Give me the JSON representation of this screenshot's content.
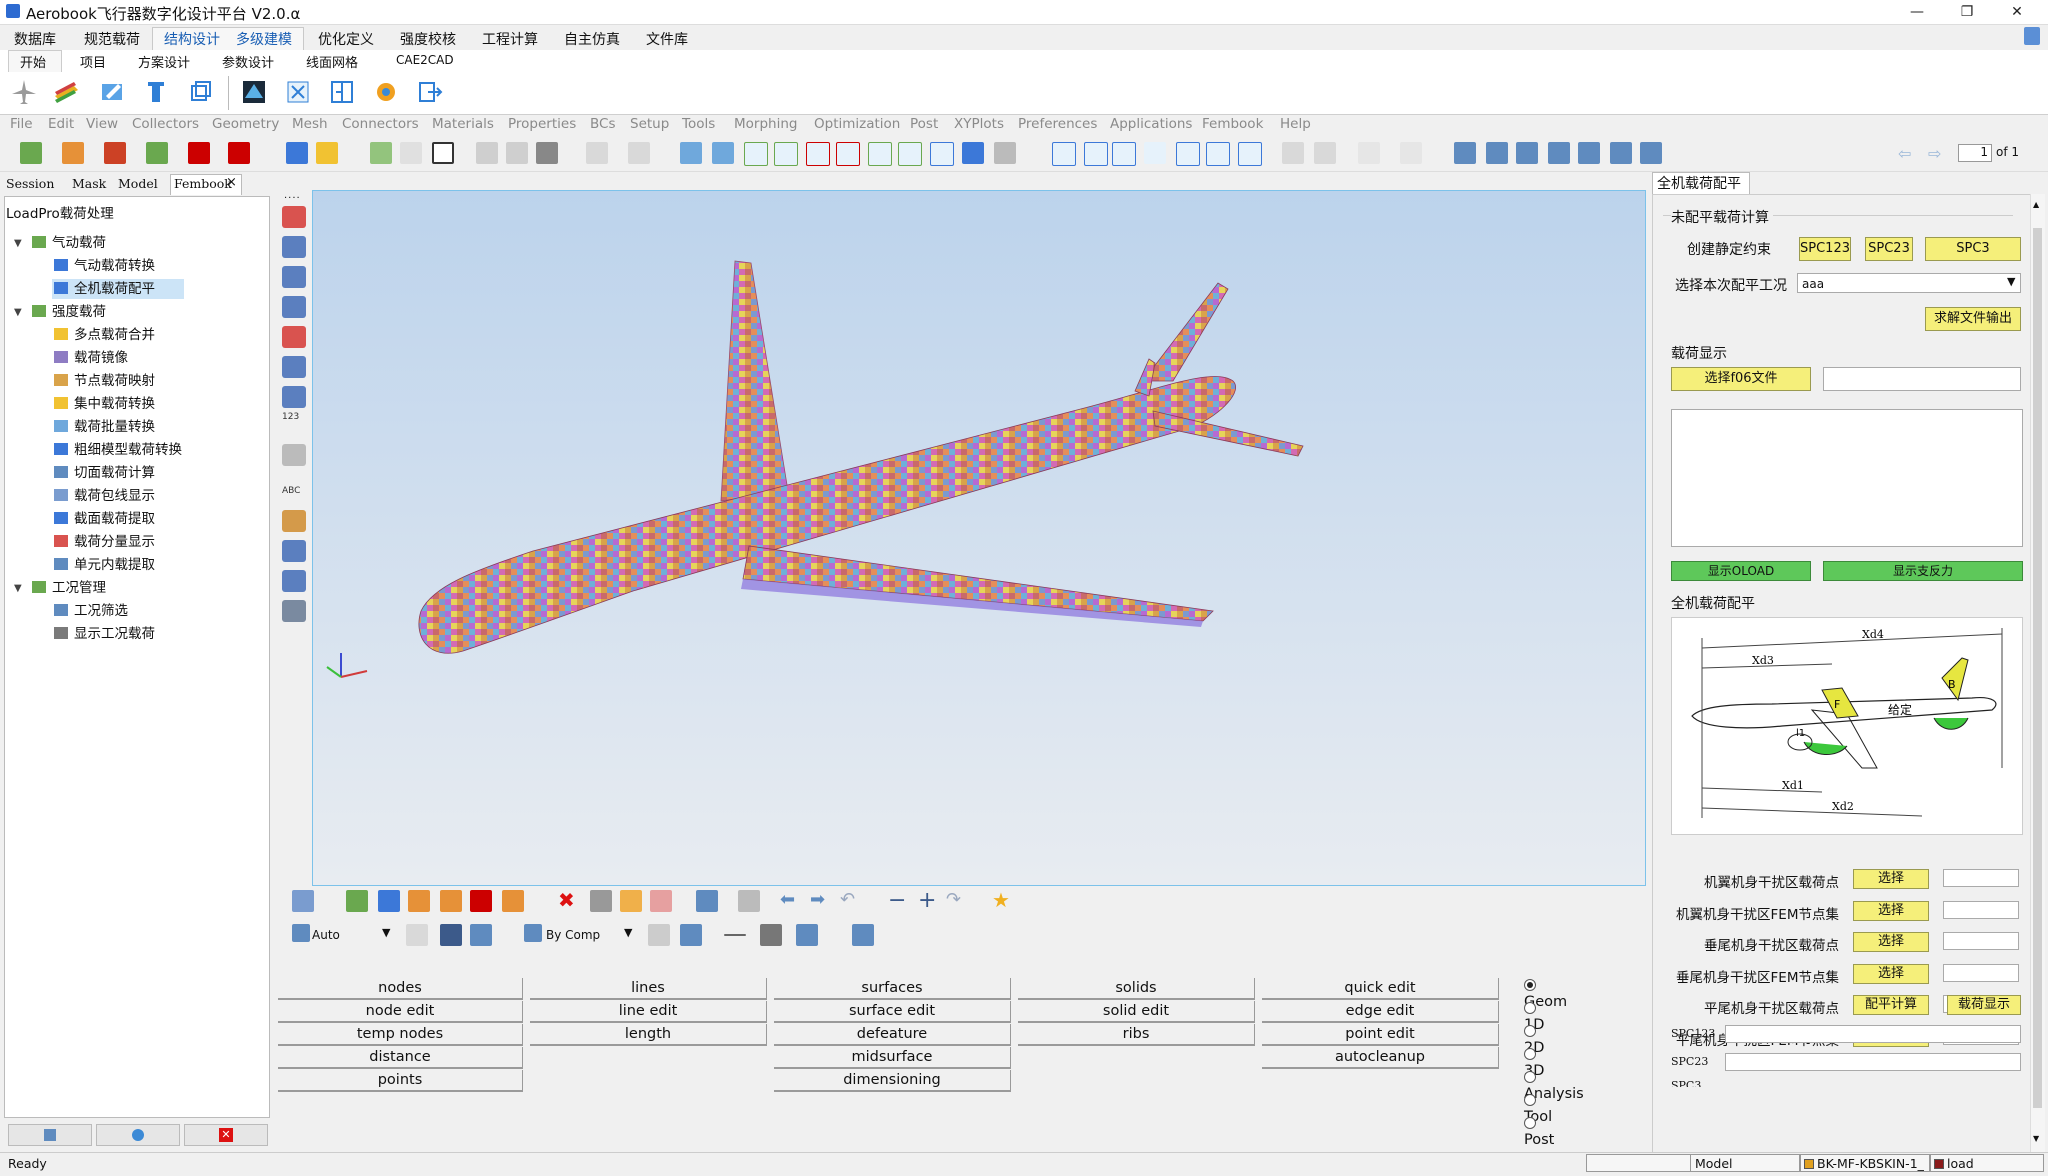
{
  "window": {
    "title": "Aerobook飞行器数字化设计平台 V2.0.α",
    "min": "—",
    "max": "❐",
    "close": "✕"
  },
  "main_menu": [
    "数据库",
    "规范载荷",
    "结构设计",
    "多级建模",
    "优化定义",
    "强度校核",
    "工程计算",
    "自主仿真",
    "文件库"
  ],
  "sub_tabs": [
    "开始",
    "项目",
    "方案设计",
    "参数设计",
    "线面网格",
    "CAE2CAD"
  ],
  "hm_menu": [
    "File",
    "Edit",
    "View",
    "Collectors",
    "Geometry",
    "Mesh",
    "Connectors",
    "Materials",
    "Properties",
    "BCs",
    "Setup",
    "Tools",
    "Morphing",
    "Optimization",
    "Post",
    "XYPlots",
    "Preferences",
    "Applications",
    "Fembook",
    "Help"
  ],
  "page_counter": {
    "value": "1",
    "of": "of 1"
  },
  "left_tabs": [
    "Session",
    "Mask",
    "Model",
    "Fembook"
  ],
  "left_tab_close": "×",
  "tree": {
    "title": "LoadPro载荷处理",
    "groups": [
      {
        "label": "气动载荷",
        "children": [
          "气动载荷转换",
          "全机载荷配平"
        ]
      },
      {
        "label": "强度载荷",
        "children": [
          "多点载荷合并",
          "载荷镜像",
          "节点载荷映射",
          "集中载荷转换",
          "载荷批量转换",
          "粗细模型载荷转换",
          "切面载荷计算",
          "载荷包线显示",
          "截面载荷提取",
          "载荷分量显示",
          "单元内载提取"
        ]
      },
      {
        "label": "工况管理",
        "children": [
          "工况筛选",
          "显示工况载荷"
        ]
      }
    ],
    "selected": "全机载荷配平"
  },
  "vtool_labels": {
    "v1": "123",
    "v2": "ABC"
  },
  "bottom_toolbar": {
    "auto": "Auto",
    "by_comp": "By Comp"
  },
  "panel": {
    "col1": [
      "nodes",
      "node edit",
      "temp nodes",
      "distance",
      "points"
    ],
    "col2": [
      "lines",
      "line edit",
      "length"
    ],
    "col3": [
      "surfaces",
      "surface edit",
      "defeature",
      "midsurface",
      "dimensioning"
    ],
    "col4": [
      "solids",
      "solid edit",
      "ribs"
    ],
    "col5": [
      "quick edit",
      "edge edit",
      "point edit",
      "autocleanup"
    ],
    "radios": [
      "Geom",
      "1D",
      "2D",
      "3D",
      "Analysis",
      "Tool",
      "Post"
    ],
    "radio_selected": "Geom"
  },
  "right_panel": {
    "tab": "全机载荷配平",
    "section1": "未配平载荷计算",
    "create_constraint": "创建静定约束",
    "spc_buttons": [
      "SPC123",
      "SPC23",
      "SPC3"
    ],
    "select_case_label": "选择本次配平工况",
    "select_case_value": "aaa",
    "solve_output": "求解文件输出",
    "section2": "载荷显示",
    "select_f06": "选择f06文件",
    "show_oload": "显示OLOAD",
    "show_reaction": "显示支反力",
    "section3": "全机载荷配平",
    "diagram_labels": {
      "xd4": "Xd4",
      "xd3": "Xd3",
      "xd1": "Xd1",
      "xd2": "Xd2",
      "l1": "l1",
      "fixed": "给定",
      "f": "F",
      "b": "B"
    },
    "pick_rows": [
      "机翼机身干扰区载荷点",
      "机翼机身干扰区FEM节点集",
      "垂尾机身干扰区载荷点",
      "垂尾机身干扰区FEM节点集",
      "平尾机身干扰区载荷点",
      "平尾机身干扰区FEM节点集"
    ],
    "pick_btn": "选择",
    "trim_calc": "配平计算",
    "load_show": "载荷显示",
    "spc_fields": [
      "SPC123",
      "SPC23",
      "SPC3"
    ]
  },
  "status": {
    "ready": "Ready",
    "model": "Model",
    "comp": "BK-MF-KBSKIN-1_",
    "load": "load"
  },
  "colors": {
    "accent": "#1a5fb4",
    "yellow_btn": "#f5ef7a",
    "green_btn": "#5ec85a",
    "viewport_border": "#7cc2ea"
  }
}
